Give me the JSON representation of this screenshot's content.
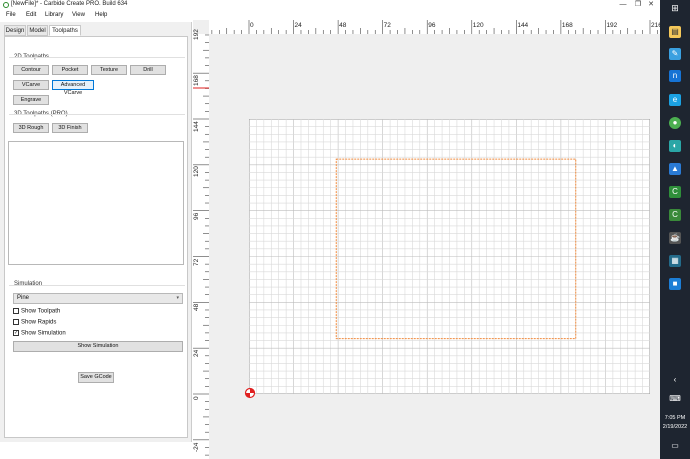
{
  "window": {
    "title": "[NewFile]* - Carbide Create PRO. Build 634",
    "minimize": "—",
    "maximize": "❐",
    "close": "✕"
  },
  "menu": [
    "File",
    "Edit",
    "Library",
    "View",
    "Help"
  ],
  "tabs": [
    {
      "label": "Design",
      "active": false
    },
    {
      "label": "Model",
      "active": false
    },
    {
      "label": "Toolpaths",
      "active": true
    }
  ],
  "toolpaths2d": {
    "label": "2D Toolpaths",
    "buttons": [
      "Contour",
      "Pocket",
      "Texture",
      "Drill",
      "VCarve",
      "Advanced VCarve",
      "Engrave"
    ]
  },
  "toolpaths3d": {
    "label": "3D Toolpaths (PRO)",
    "buttons": [
      "3D Rough",
      "3D Finish"
    ]
  },
  "simulation": {
    "label": "Simulation",
    "material": "Pine",
    "show_toolpath": {
      "label": "Show Toolpath",
      "checked": false
    },
    "show_rapids": {
      "label": "Show Rapids",
      "checked": false
    },
    "show_simulation": {
      "label": "Show Simulation",
      "checked": true
    },
    "button": "Show Simulation"
  },
  "save_gcode": "Save GCode",
  "canvas": {
    "units_per_grid": 4,
    "stock": {
      "x_min": 0,
      "x_max": 216,
      "y_min": 0,
      "y_max": 144
    },
    "design_rect": {
      "x_min": 47,
      "x_max": 176,
      "y_min": 29,
      "y_max": 123
    },
    "ruler_x": [
      "0",
      "24",
      "48",
      "72",
      "96",
      "120",
      "144",
      "168",
      "192",
      "216"
    ],
    "ruler_y": [
      "192",
      "168",
      "144",
      "120",
      "96",
      "72",
      "48",
      "24",
      "0",
      "-24"
    ],
    "colors": {
      "grid": "#d9d9d9",
      "grid_major": "#bdbdbd",
      "design": "#f08a3c",
      "origin": "#e02020"
    }
  },
  "taskbar": {
    "time": "7:05 PM",
    "date": "2/19/2022"
  }
}
